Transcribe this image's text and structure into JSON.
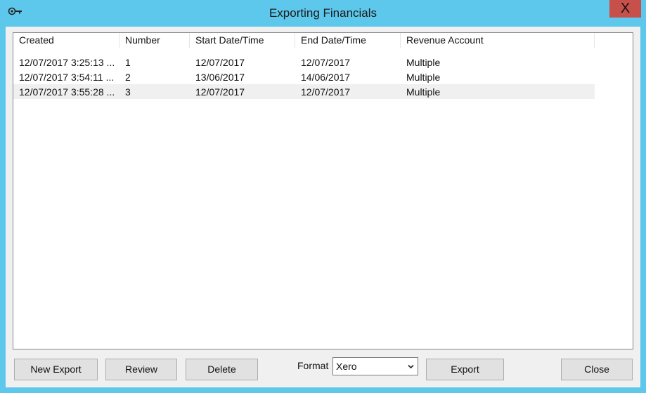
{
  "window": {
    "title": "Exporting Financials",
    "close_glyph": "X"
  },
  "list": {
    "columns": [
      "Created",
      "Number",
      "Start Date/Time",
      "End Date/Time",
      "Revenue Account"
    ],
    "rows": [
      [
        "12/07/2017 3:25:13 ...",
        "1",
        "12/07/2017",
        "12/07/2017",
        "Multiple"
      ],
      [
        "12/07/2017 3:54:11 ...",
        "2",
        "13/06/2017",
        "14/06/2017",
        "Multiple"
      ],
      [
        "12/07/2017 3:55:28 ...",
        "3",
        "12/07/2017",
        "12/07/2017",
        "Multiple"
      ]
    ],
    "selected_row": 3
  },
  "buttons": {
    "new_export": "New Export",
    "review": "Review",
    "delete": "Delete",
    "export": "Export",
    "close": "Close"
  },
  "format": {
    "label": "Format",
    "value": "Xero"
  },
  "colors": {
    "titlebar": "#5ec8ec",
    "close": "#c7504b"
  },
  "icons": [
    "app-icon",
    "close-icon",
    "chevron-down-icon"
  ]
}
